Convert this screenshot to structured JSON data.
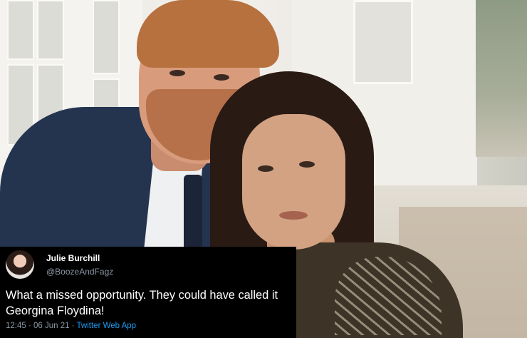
{
  "tweet": {
    "author_name": "Julie Burchill",
    "author_handle": "@BoozeAndFagz",
    "text": "What a missed opportunity. They could have called it Georgina Floydina!",
    "time": "12:45",
    "separator_1": " · ",
    "date": "06 Jun 21",
    "separator_2": " · ",
    "source": "Twitter Web App",
    "source_color": "#1d9bf0",
    "background_color": "#000000"
  },
  "icons": {
    "avatar": "profile-photo"
  }
}
